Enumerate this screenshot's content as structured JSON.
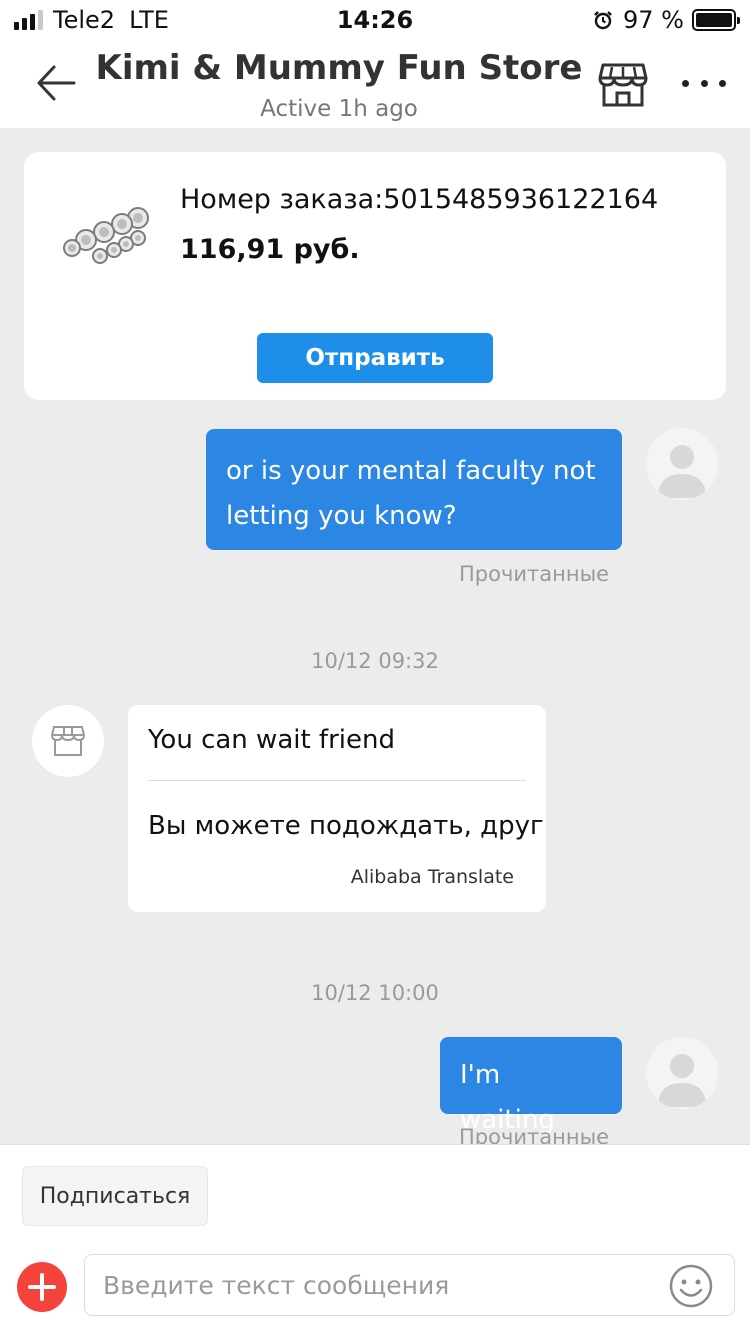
{
  "status_bar": {
    "carrier": "Tele2",
    "network": "LTE",
    "time": "14:26",
    "battery": "97 %"
  },
  "header": {
    "title": "Kimi & Mummy Fun Store",
    "subtitle": "Active 1h ago",
    "icons": {
      "back": "arrow-left-icon",
      "store": "store-icon",
      "more": "more-dots-icon"
    }
  },
  "order": {
    "number": "Номер заказа:5015485936122164",
    "price": "116,91 руб.",
    "send_label": "Отправить"
  },
  "messages": [
    {
      "direction": "out",
      "text": "or is your mental faculty not letting you know?",
      "status": "Прочитанные"
    },
    {
      "type": "timestamp",
      "text": "10/12 09:32"
    },
    {
      "direction": "in",
      "text": "You can wait friend",
      "translation": "Вы можете подождать, друг",
      "translator": "Alibaba Translate"
    },
    {
      "type": "timestamp",
      "text": "10/12 10:00"
    },
    {
      "direction": "out",
      "text": "I'm waiting",
      "status": "Прочитанные"
    }
  ],
  "bottom": {
    "subscribe_label": "Подписаться",
    "input_placeholder": "Введите текст сообщения"
  },
  "colors": {
    "accent_blue": "#2b87e3",
    "button_blue": "#1e8ee8",
    "plus_red": "#f4433a",
    "chat_bg": "#ececec"
  }
}
